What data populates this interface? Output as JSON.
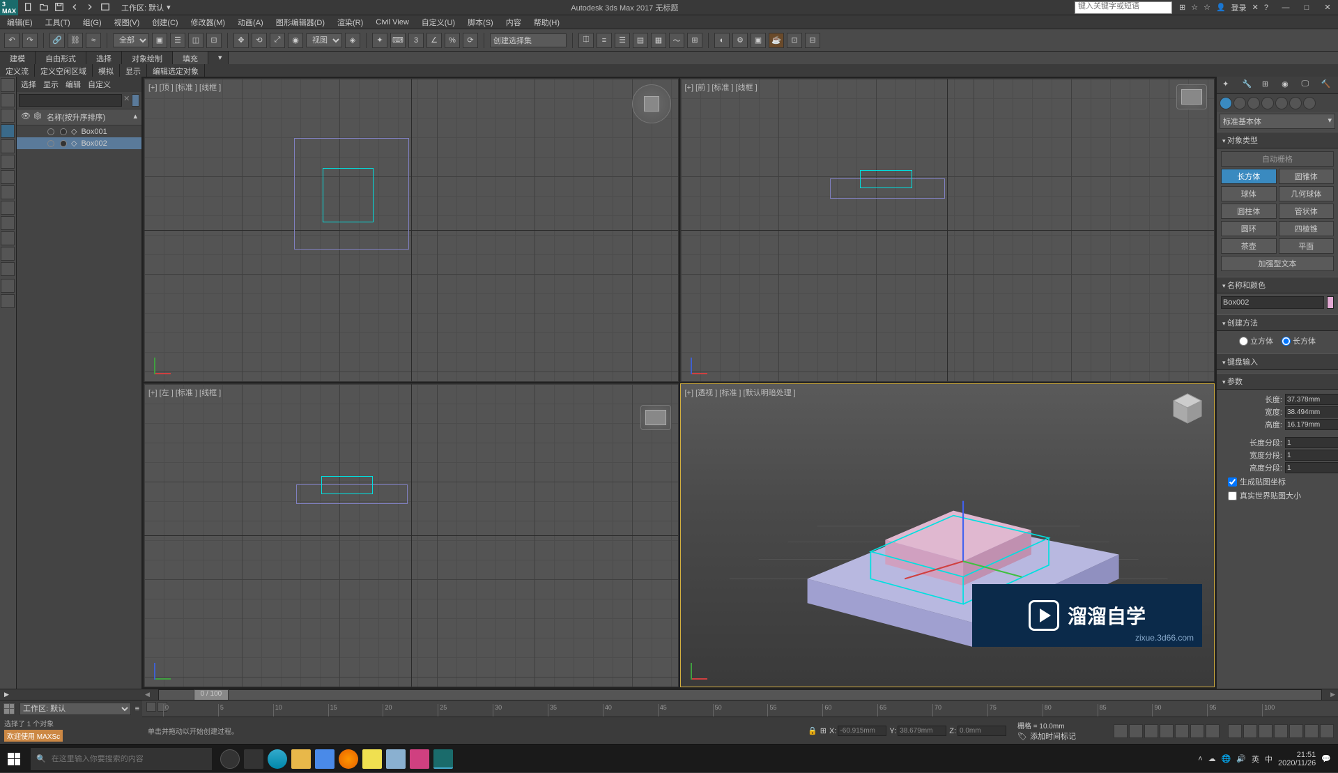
{
  "app": {
    "title": "Autodesk 3ds Max 2017    无标题",
    "workspace_label": "工作区: 默认",
    "search_placeholder": "键入关键字或短语",
    "login": "登录"
  },
  "menu": [
    "编辑(E)",
    "工具(T)",
    "组(G)",
    "视图(V)",
    "创建(C)",
    "修改器(M)",
    "动画(A)",
    "图形编辑器(D)",
    "渲染(R)",
    "Civil View",
    "自定义(U)",
    "脚本(S)",
    "内容",
    "帮助(H)"
  ],
  "toolbar": {
    "filter": "全部",
    "ref": "视图",
    "selset": "创建选择集"
  },
  "ribbon": {
    "tabs": [
      "建模",
      "自由形式",
      "选择",
      "对象绘制",
      "填充"
    ],
    "subtabs": [
      "定义流",
      "定义空闲区域",
      "模拟",
      "显示",
      "编辑选定对象"
    ]
  },
  "scene_explorer": {
    "menu": [
      "选择",
      "显示",
      "编辑",
      "自定义"
    ],
    "header": "名称(按升序排序)",
    "items": [
      {
        "name": "Box001",
        "selected": false
      },
      {
        "name": "Box002",
        "selected": true
      }
    ]
  },
  "viewports": {
    "top": "[+] [顶 ] [标准 ] [线框 ]",
    "front": "[+] [前 ] [标准 ] [线框 ]",
    "left": "[+] [左 ] [标准 ] [线框 ]",
    "persp": "[+] [透视 ] [标准 ] [默认明暗处理 ]"
  },
  "right_panel": {
    "dropdown": "标准基本体",
    "rollouts": {
      "object_type": "对象类型",
      "autogrid": "自动栅格",
      "name_color": "名称和颜色",
      "creation_method": "创建方法",
      "keyboard_entry": "键盘输入",
      "parameters": "参数"
    },
    "primitives": [
      {
        "label": "长方体",
        "active": true
      },
      {
        "label": "圆锥体",
        "active": false
      },
      {
        "label": "球体",
        "active": false
      },
      {
        "label": "几何球体",
        "active": false
      },
      {
        "label": "圆柱体",
        "active": false
      },
      {
        "label": "管状体",
        "active": false
      },
      {
        "label": "圆环",
        "active": false
      },
      {
        "label": "四棱锥",
        "active": false
      },
      {
        "label": "茶壶",
        "active": false
      },
      {
        "label": "平面",
        "active": false
      },
      {
        "label": "加强型文本",
        "active": false
      }
    ],
    "object_name": "Box002",
    "creation_options": {
      "cube": "立方体",
      "box": "长方体"
    },
    "params": {
      "length_label": "长度:",
      "length": "37.378mm",
      "width_label": "宽度:",
      "width": "38.494mm",
      "height_label": "高度:",
      "height": "16.179mm",
      "lsegs_label": "长度分段:",
      "lsegs": "1",
      "wsegs_label": "宽度分段:",
      "wsegs": "1",
      "hsegs_label": "高度分段:",
      "hsegs": "1",
      "gen_mapping": "生成贴图坐标",
      "real_world": "真实世界贴图大小"
    }
  },
  "timeline": {
    "frame_label": "0 / 100",
    "ticks": [
      "0",
      "5",
      "10",
      "15",
      "20",
      "25",
      "30",
      "35",
      "40",
      "45",
      "50",
      "55",
      "60",
      "65",
      "70",
      "75",
      "80",
      "85",
      "90",
      "95",
      "100"
    ]
  },
  "status": {
    "welcome": "欢迎使用 MAXSc",
    "selection": "选择了 1 个对象",
    "prompt": "单击并拖动以开始创建过程。",
    "x": "-60.915mm",
    "y": "38.679mm",
    "z": "0.0mm",
    "grid": "栅格 = 10.0mm",
    "autokey": "添加时间标记"
  },
  "layout": {
    "workspace": "工作区: 默认"
  },
  "taskbar": {
    "search_placeholder": "在这里输入你要搜索的内容",
    "time": "21:51",
    "date": "2020/11/26"
  },
  "watermark": {
    "text": "溜溜自学",
    "url": "zixue.3d66.com"
  }
}
